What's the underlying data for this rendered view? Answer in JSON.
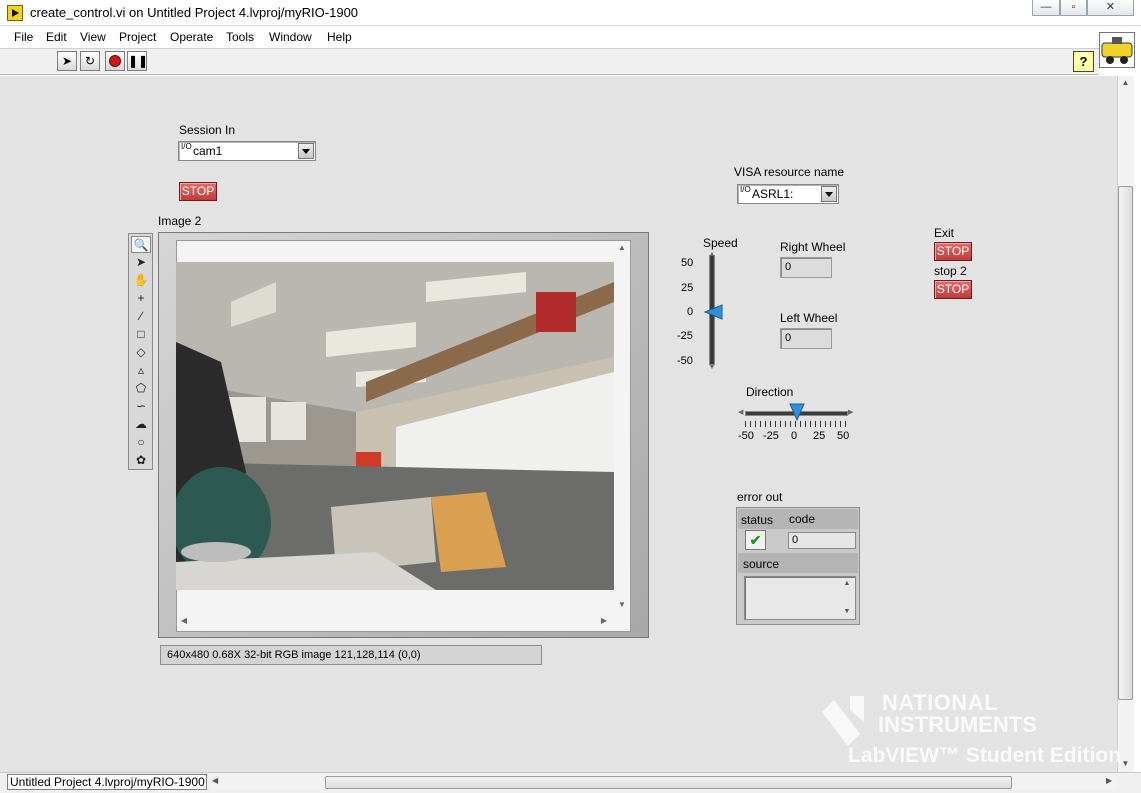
{
  "window": {
    "title": "create_control.vi on Untitled Project 4.lvproj/myRIO-1900",
    "min_glyph": "—",
    "max_glyph": "▫",
    "close_glyph": "✕"
  },
  "menu": [
    "File",
    "Edit",
    "View",
    "Project",
    "Operate",
    "Tools",
    "Window",
    "Help"
  ],
  "toolbar": {
    "run_icon": "run-arrow-icon",
    "run_cont_icon": "run-continuously-icon",
    "abort_icon": "abort-icon",
    "pause_icon": "pause-icon",
    "help_label": "?"
  },
  "controls": {
    "session_in": {
      "label": "Session In",
      "radix": "I/O",
      "value": "cam1"
    },
    "stop1": {
      "label": "STOP"
    },
    "image": {
      "label": "Image 2",
      "status": "640x480 0.68X 32-bit RGB image 121,128,114     (0,0)"
    },
    "visa": {
      "label": "VISA resource name",
      "radix": "I/O",
      "value": "ASRL1:"
    },
    "speed": {
      "label": "Speed",
      "ticks": [
        "50",
        "25",
        "0",
        "-25",
        "-50"
      ],
      "value": 0,
      "min": -50,
      "max": 50
    },
    "right_wheel": {
      "label": "Right Wheel",
      "value": "0"
    },
    "left_wheel": {
      "label": "Left Wheel",
      "value": "0"
    },
    "direction": {
      "label": "Direction",
      "ticks": [
        "-50",
        "-25",
        "0",
        "25",
        "50"
      ],
      "value": 0,
      "min": -50,
      "max": 50
    },
    "exit": {
      "label": "Exit",
      "button": "STOP"
    },
    "stop2": {
      "label": "stop 2",
      "button": "STOP"
    },
    "error_out": {
      "label": "error out",
      "status_label": "status",
      "code_label": "code",
      "code_value": "0",
      "source_label": "source",
      "status_ok": true
    }
  },
  "watermark": {
    "line1": "NATIONAL",
    "line2": "INSTRUMENTS",
    "line3": "LabVIEW™ Student Edition"
  },
  "statusbar": {
    "context": "Untitled Project 4.lvproj/myRIO-1900"
  }
}
